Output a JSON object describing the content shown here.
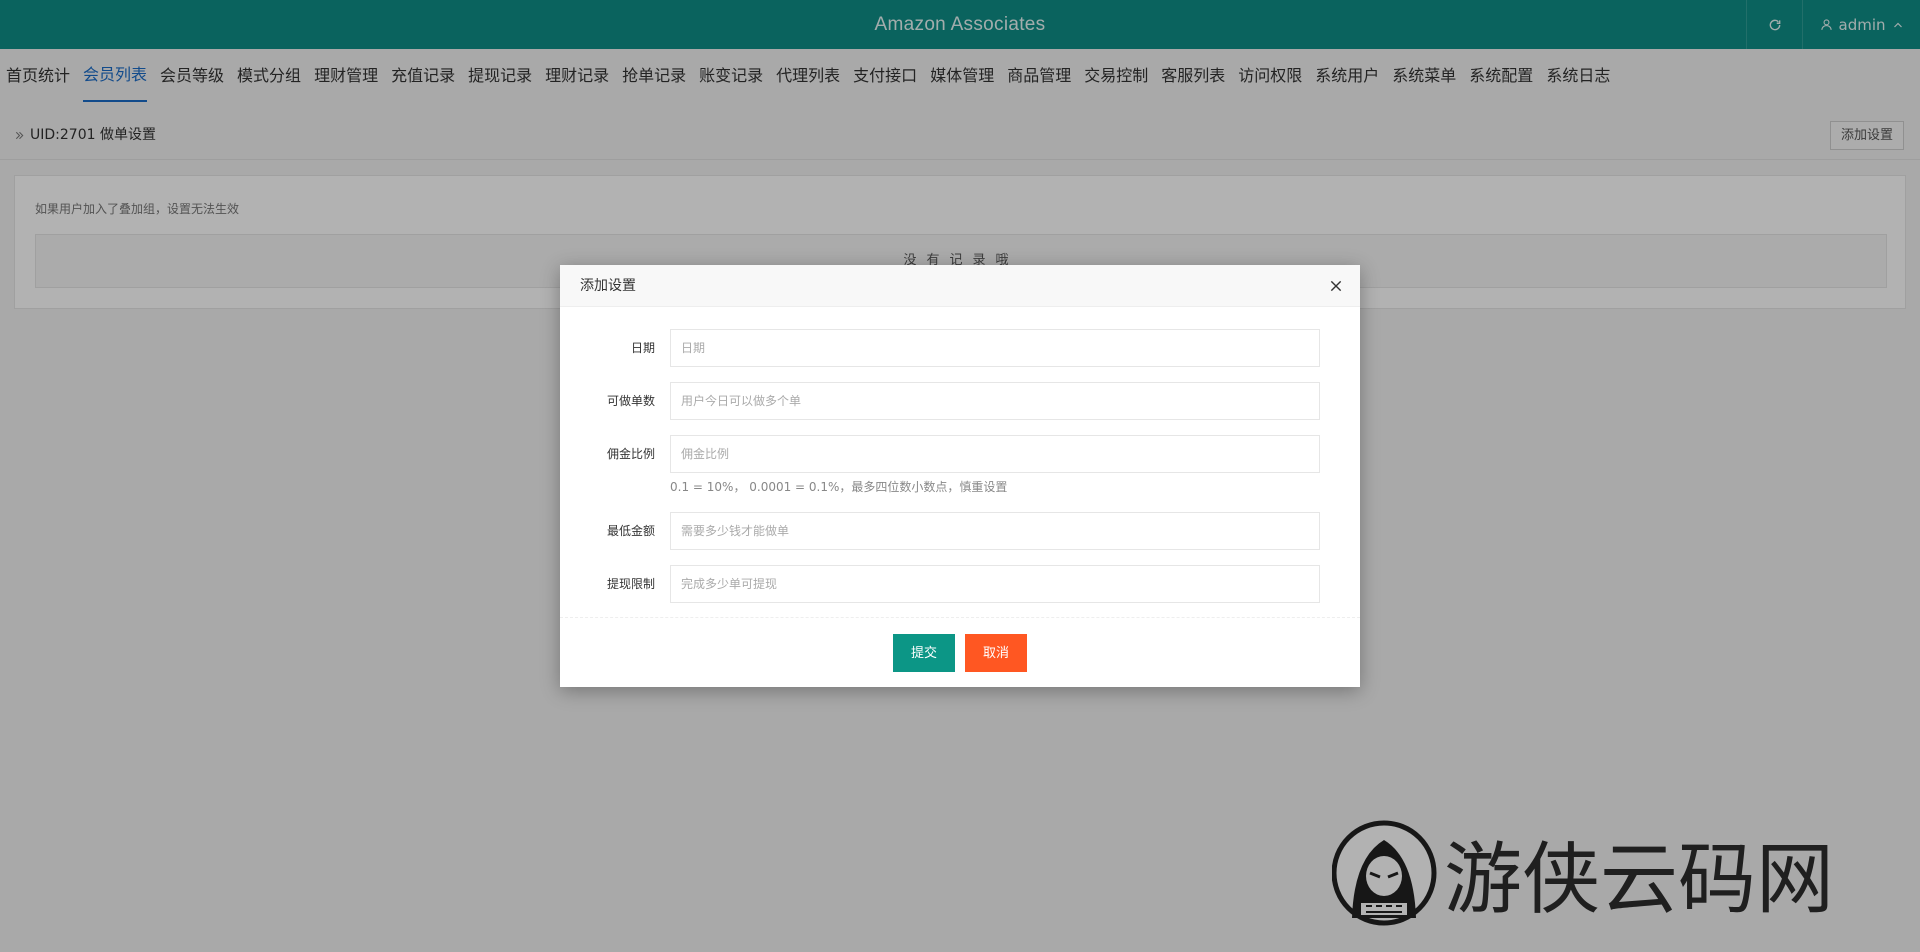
{
  "header": {
    "title": "Amazon Associates",
    "user_label": "admin"
  },
  "menu": {
    "items": [
      {
        "label": "首页统计"
      },
      {
        "label": "会员列表"
      },
      {
        "label": "会员等级"
      },
      {
        "label": "模式分组"
      },
      {
        "label": "理财管理"
      },
      {
        "label": "充值记录"
      },
      {
        "label": "提现记录"
      },
      {
        "label": "理财记录"
      },
      {
        "label": "抢单记录"
      },
      {
        "label": "账变记录"
      },
      {
        "label": "代理列表"
      },
      {
        "label": "支付接口"
      },
      {
        "label": "媒体管理"
      },
      {
        "label": "商品管理"
      },
      {
        "label": "交易控制"
      },
      {
        "label": "客服列表"
      },
      {
        "label": "访问权限"
      },
      {
        "label": "系统用户"
      },
      {
        "label": "系统菜单"
      },
      {
        "label": "系统配置"
      },
      {
        "label": "系统日志"
      }
    ],
    "active": "会员列表"
  },
  "breadcrumb": {
    "text": "UID:2701 做单设置",
    "add_button": "添加设置"
  },
  "content": {
    "note": "如果用户加入了叠加组，设置无法生效",
    "empty_text": "没有记录哦"
  },
  "modal": {
    "title": "添加设置",
    "fields": [
      {
        "label": "日期",
        "placeholder": "日期"
      },
      {
        "label": "可做单数",
        "placeholder": "用户今日可以做多个单"
      },
      {
        "label": "佣金比例",
        "placeholder": "佣金比例",
        "hint": "0.1 = 10%， 0.0001 = 0.1%，最多四位数小数点，慎重设置"
      },
      {
        "label": "最低金额",
        "placeholder": "需要多少钱才能做单"
      },
      {
        "label": "提现限制",
        "placeholder": "完成多少单可提现"
      }
    ],
    "submit": "提交",
    "cancel": "取消"
  },
  "watermark": {
    "text": "游侠云码网"
  },
  "colors": {
    "header_bg": "#0f8f87",
    "menu_active": "#1b6cc8",
    "submit_bg": "#0c9686",
    "cancel_bg": "#ff5722"
  },
  "icons": {
    "refresh": "refresh-icon",
    "user": "user-icon",
    "chevron": "chevron-up-icon",
    "breadcrumb": "double-chevron-right-icon",
    "close": "close-icon"
  }
}
